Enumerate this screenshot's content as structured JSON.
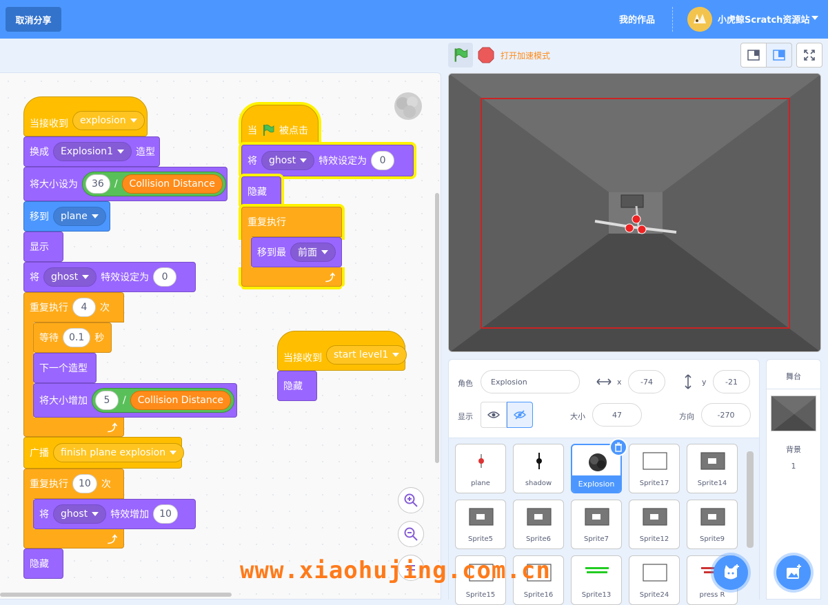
{
  "header": {
    "cancel_share": "取消分享",
    "my_works": "我的作品",
    "site_name": "小虎鲸Scratch资源站"
  },
  "toolbar": {
    "turbo_mode": "打开加速模式"
  },
  "scripts": {
    "s1": {
      "hat_label": "当接收到",
      "hat_msg": "explosion",
      "switch_label": "换成",
      "switch_costume": "Explosion1",
      "switch_suffix": "造型",
      "setsize_label": "将大小设为",
      "setsize_num": "36",
      "div": "/",
      "collision": "Collision Distance",
      "goto_label": "移到",
      "goto_target": "plane",
      "show": "显示",
      "seteffect_label": "将",
      "effect": "ghost",
      "seteffect_mid": "特效设定为",
      "seteffect_val": "0",
      "repeat_label": "重复执行",
      "repeat1_times": "4",
      "times_suffix": "次",
      "wait_label": "等待",
      "wait_val": "0.1",
      "wait_suffix": "秒",
      "next_costume": "下一个造型",
      "changesize_label": "将大小增加",
      "changesize_num": "5",
      "broadcast_label": "广播",
      "broadcast_msg": "finish plane explosion",
      "repeat2_times": "10",
      "changeeffect_mid": "特效增加",
      "changeeffect_val": "10",
      "hide": "隐藏"
    },
    "s2": {
      "hat_prefix": "当",
      "hat_suffix": "被点击",
      "seteffect_label": "将",
      "effect": "ghost",
      "seteffect_mid": "特效设定为",
      "seteffect_val": "0",
      "hide": "隐藏",
      "forever": "重复执行",
      "front_label": "移到最",
      "front_val": "前面"
    },
    "s3": {
      "hat_label": "当接收到",
      "hat_msg": "start level1",
      "hide": "隐藏"
    }
  },
  "sprite_info": {
    "sprite_label": "角色",
    "sprite_name": "Explosion",
    "x_label": "x",
    "x_val": "-74",
    "y_label": "y",
    "y_val": "-21",
    "show_label": "显示",
    "size_label": "大小",
    "size_val": "47",
    "direction_label": "方向",
    "direction_val": "-270"
  },
  "sprites": [
    {
      "name": "plane"
    },
    {
      "name": "shadow"
    },
    {
      "name": "Explosion",
      "selected": true
    },
    {
      "name": "Sprite17"
    },
    {
      "name": "Sprite14"
    },
    {
      "name": "Sprite5"
    },
    {
      "name": "Sprite6"
    },
    {
      "name": "Sprite7"
    },
    {
      "name": "Sprite12"
    },
    {
      "name": "Sprite9"
    },
    {
      "name": "Sprite15"
    },
    {
      "name": "Sprite16"
    },
    {
      "name": "Sprite13"
    },
    {
      "name": "Sprite24"
    },
    {
      "name": "press R"
    }
  ],
  "stage_panel": {
    "title": "舞台",
    "backdrop_label": "背景",
    "backdrop_count": "1"
  },
  "watermark": "www.xiaohujing.com.cn",
  "colors": {
    "header": "#4c97ff",
    "events": "#ffbf00",
    "looks": "#9966ff",
    "motion": "#4c97ff",
    "control": "#ffab19",
    "operators": "#59c059"
  }
}
